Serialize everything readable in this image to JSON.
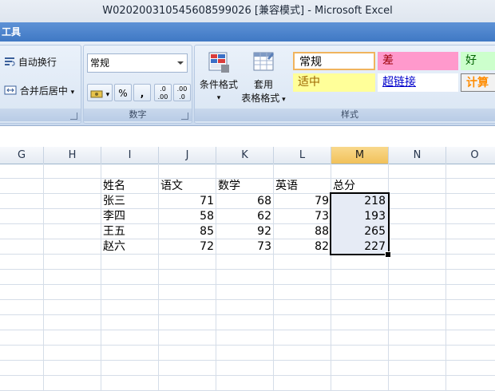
{
  "window": {
    "title": "W020200310545608599026  [兼容模式] - Microsoft Excel"
  },
  "ribbon": {
    "tab_fragment": "工具",
    "alignment": {
      "wrap_text": "自动换行",
      "merge_center": "合并后居中"
    },
    "number": {
      "format_value": "常规",
      "percent": "%",
      "comma": ",",
      "increase_decimal": ".0 .00",
      "decrease_decimal": ".00 .0",
      "label": "数字"
    },
    "styles": {
      "conditional_format": "条件格式",
      "table_format_line1": "套用",
      "table_format_line2": "表格格式",
      "cells": [
        {
          "text": "常规"
        },
        {
          "text": "差"
        },
        {
          "text": "好"
        },
        {
          "text": "适中"
        },
        {
          "text": "超链接"
        },
        {
          "text": "计算"
        }
      ],
      "label": "样式"
    }
  },
  "columns": [
    "G",
    "H",
    "I",
    "J",
    "K",
    "L",
    "M",
    "N",
    "O"
  ],
  "active_column": "M",
  "sheet": {
    "headers": [
      "姓名",
      "语文",
      "数学",
      "英语",
      "总分"
    ],
    "rows": [
      [
        "张三",
        "71",
        "68",
        "79",
        "218"
      ],
      [
        "李四",
        "58",
        "62",
        "73",
        "193"
      ],
      [
        "王五",
        "85",
        "92",
        "88",
        "265"
      ],
      [
        "赵六",
        "72",
        "73",
        "82",
        "227"
      ]
    ]
  },
  "colors": {
    "style_bad": "#ff99cc",
    "style_good": "#ccffcc",
    "style_neutral": "#ffff99",
    "style_calc": "#ff8c00",
    "hyperlink": "#0000cc",
    "selection": "#000000"
  }
}
